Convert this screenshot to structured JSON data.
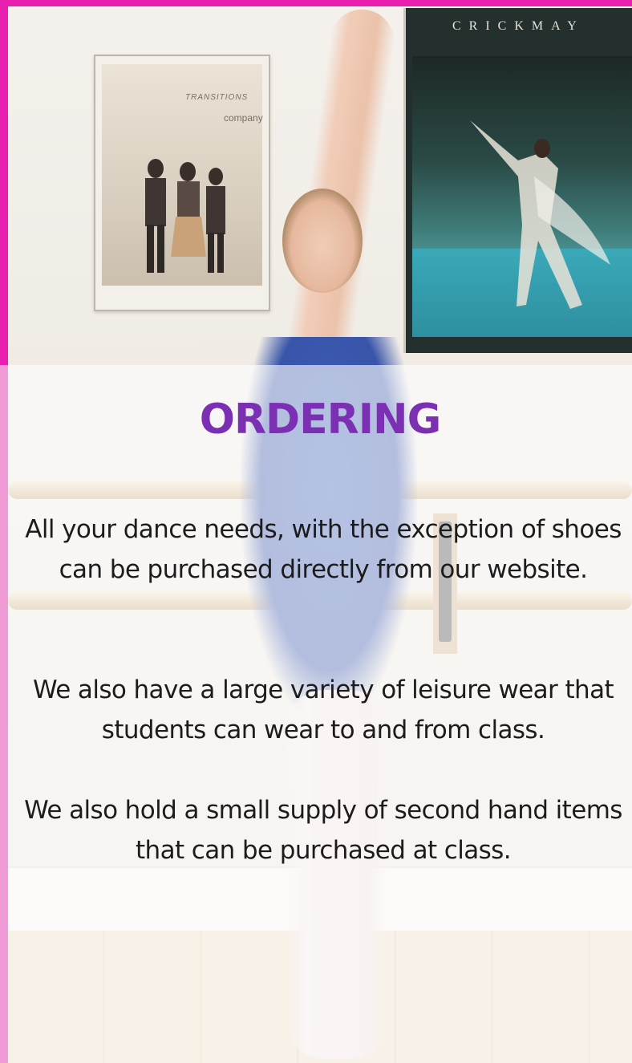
{
  "section": {
    "heading": "ORDERING",
    "paragraphs": [
      "All your dance needs, with the exception of shoes can be purchased directly from our website.",
      "We also have a large variety of leisure wear that students can wear to and from class.",
      "We also hold a small supply of second hand items that can be purchased at class."
    ]
  },
  "background_photo": {
    "poster_left": {
      "line1": "TRANSITIONS",
      "line2": "company"
    },
    "poster_right": {
      "title": "CRICKMAY"
    }
  },
  "colors": {
    "heading": "#7b2fb3",
    "border_top": "#e91fb0",
    "border_light": "#f09ad6"
  }
}
